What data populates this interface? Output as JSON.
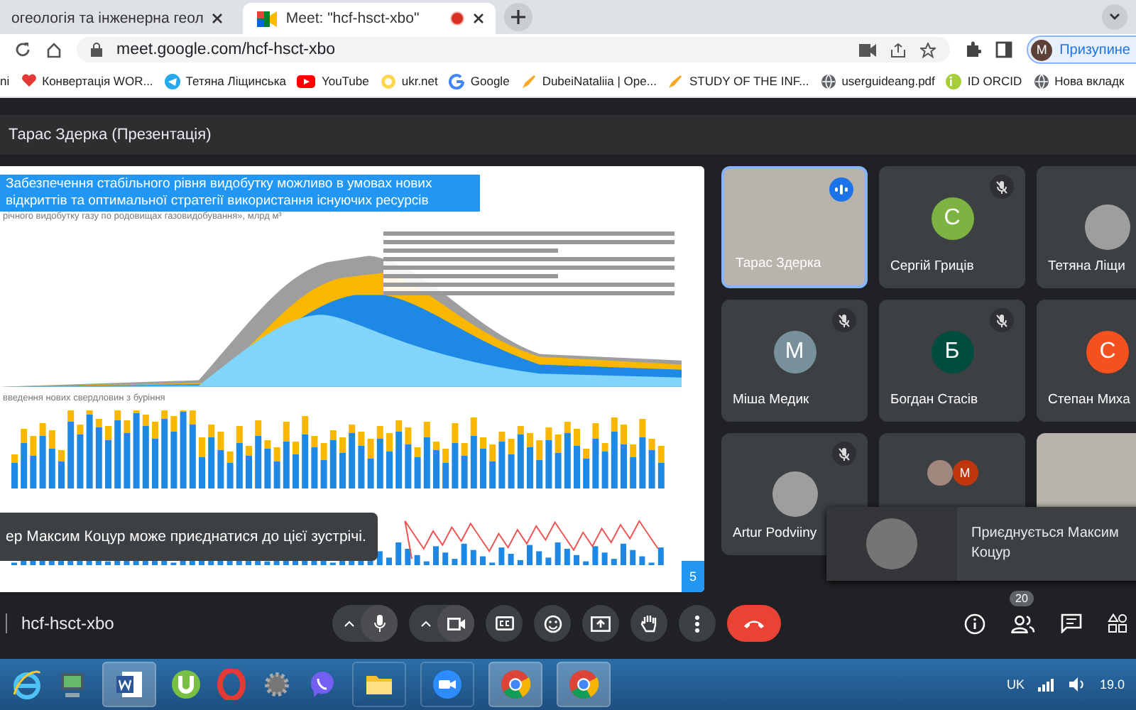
{
  "browser": {
    "tabs": [
      {
        "title": "огеологія та інженерна геол",
        "selected": false
      },
      {
        "title": "Meet: \"hcf-hsct-xbo\"",
        "selected": true
      }
    ],
    "url": "meet.google.com/hcf-hsct-xbo",
    "profile": {
      "initial": "M",
      "label": "Призупине"
    },
    "bookmarks": [
      {
        "label": "ni",
        "kind": "none"
      },
      {
        "label": "Конвертація WOR...",
        "kind": "heart"
      },
      {
        "label": "Тетяна Ліщинська",
        "kind": "telegram"
      },
      {
        "label": "YouTube",
        "kind": "youtube"
      },
      {
        "label": "ukr.net",
        "kind": "ukr"
      },
      {
        "label": "Google",
        "kind": "google"
      },
      {
        "label": "DubeiNataliia | Ope...",
        "kind": "pen"
      },
      {
        "label": "STUDY OF THE INF...",
        "kind": "pen"
      },
      {
        "label": "userguideang.pdf",
        "kind": "globe"
      },
      {
        "label": "ID ORCID",
        "kind": "orcid"
      },
      {
        "label": "Нова вкладк",
        "kind": "globe"
      }
    ]
  },
  "meet": {
    "presenter_title": "Тарас Здерка (Презентація)",
    "slide": {
      "title": "Забезпечення стабільного рівня видобутку можливо в умовах нових відкриттів та оптимальної стратегії використання існуючих ресурсів",
      "chart_subtitle": "річного видобутку газу по родовищах газовидобування», млрд м³",
      "bars_subtitle": "введення нових свердловин з буріння",
      "page_number": "5"
    },
    "notice": "ер Максим Коцур може приєднатися до цієї зустрічі.",
    "participants": [
      {
        "name": "Тарас Здерка",
        "kind": "video",
        "muted": false,
        "speaking": true
      },
      {
        "name": "Сергій Гриців",
        "kind": "avatar",
        "initial": "С",
        "color": "#7cb342",
        "muted": true,
        "speaking": false
      },
      {
        "name": "Тетяна Ліщи",
        "kind": "photo",
        "muted": false,
        "speaking": false
      },
      {
        "name": "Міша Медик",
        "kind": "avatar",
        "initial": "М",
        "color": "#78909c",
        "muted": true,
        "speaking": false
      },
      {
        "name": "Богдан Стасів",
        "kind": "avatar",
        "initial": "Б",
        "color": "#004d40",
        "muted": true,
        "speaking": false
      },
      {
        "name": "Степан Миха",
        "kind": "avatar",
        "initial": "С",
        "color": "#f4511e",
        "muted": false,
        "speaking": false
      },
      {
        "name": "Artur Podviiny",
        "kind": "photo",
        "muted": true,
        "speaking": false
      },
      {
        "kind": "group",
        "initial": "М",
        "color": "#bf360c",
        "muted": false,
        "speaking": false
      },
      {
        "kind": "video",
        "muted": false,
        "speaking": false
      }
    ],
    "join_toast": "Приєднується Максим Коцур",
    "meeting_code": "hcf-hsct-xbo",
    "people_count": "20"
  },
  "taskbar": {
    "language": "UK",
    "clock": "19.0"
  }
}
